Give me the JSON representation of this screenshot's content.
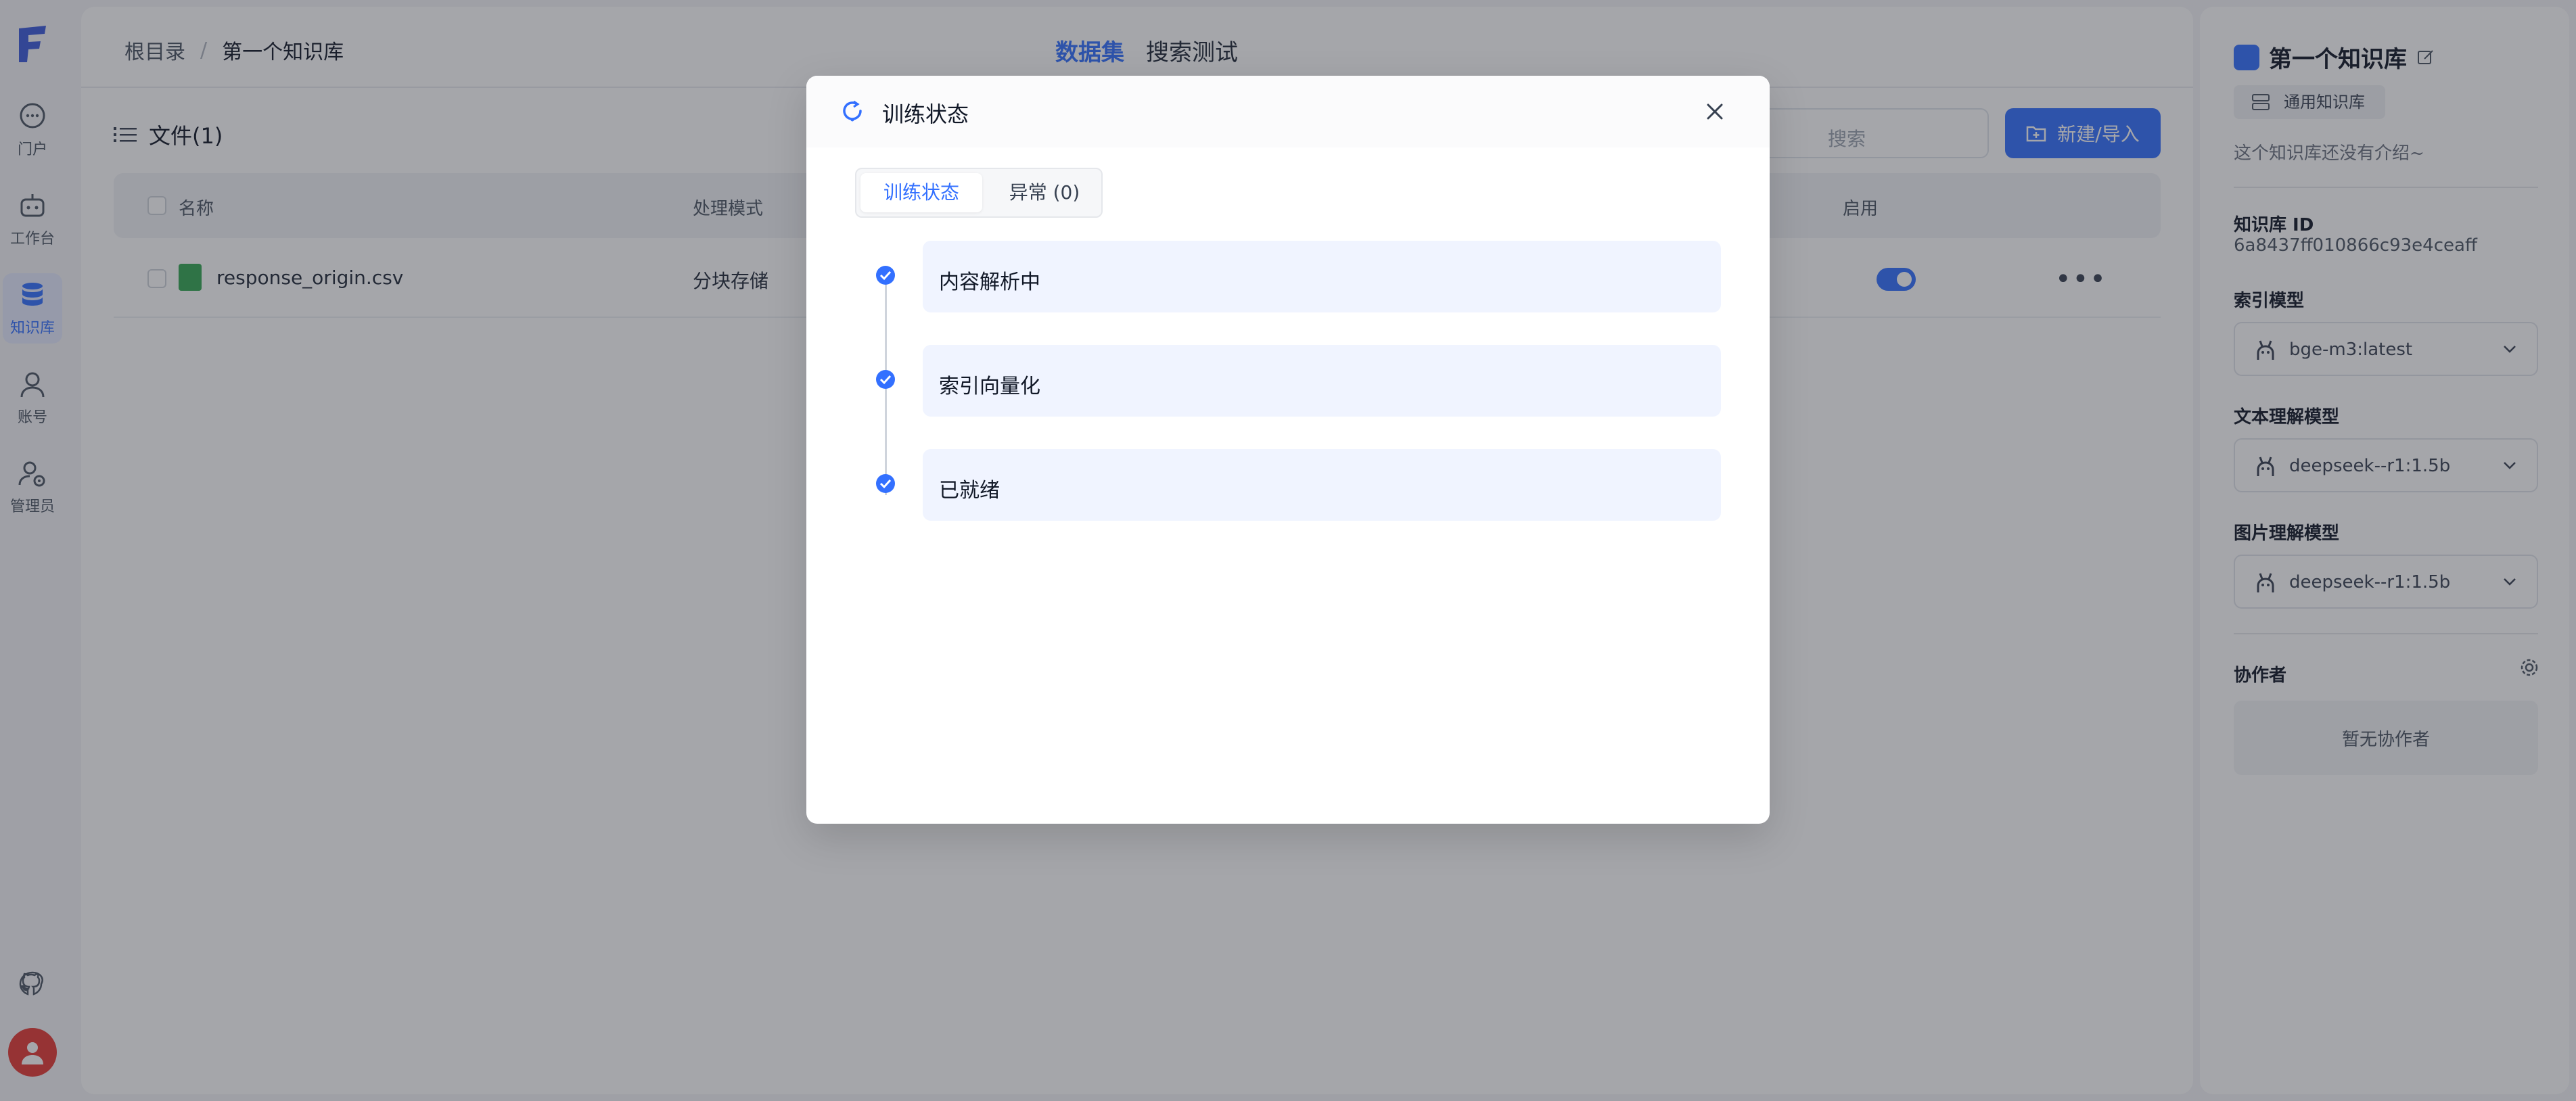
{
  "nav": {
    "items": [
      {
        "label": "门户",
        "icon": "chat-bubble-icon"
      },
      {
        "label": "工作台",
        "icon": "robot-icon"
      },
      {
        "label": "知识库",
        "icon": "database-icon"
      },
      {
        "label": "账号",
        "icon": "user-icon"
      },
      {
        "label": "管理员",
        "icon": "user-gear-icon"
      }
    ]
  },
  "header": {
    "breadcrumb_root": "根目录",
    "breadcrumb_sep": "/",
    "breadcrumb_current": "第一个知识库",
    "tab_dataset": "数据集",
    "tab_search_test": "搜索测试"
  },
  "files": {
    "title": "文件(1)",
    "search_placeholder": "搜索",
    "new_import_label": "新建/导入",
    "columns": {
      "name": "名称",
      "mode": "处理模式",
      "enabled": "启用"
    },
    "rows": [
      {
        "name": "response_origin.csv",
        "mode": "分块存储",
        "enabled": true
      }
    ]
  },
  "right_panel": {
    "kb_name": "第一个知识库",
    "kb_type": "通用知识库",
    "description": "这个知识库还没有介绍~",
    "kb_id_label": "知识库 ID",
    "kb_id": "6a8437ff010866c93e4ceaff",
    "index_model_label": "索引模型",
    "index_model": "bge-m3:latest",
    "text_model_label": "文本理解模型",
    "text_model": "deepseek--r1:1.5b",
    "image_model_label": "图片理解模型",
    "image_model": "deepseek--r1:1.5b",
    "collaborators_label": "协作者",
    "no_collaborators": "暂无协作者"
  },
  "modal": {
    "title": "训练状态",
    "tab_active": "训练状态",
    "tab_errors": "异常 (0)",
    "steps": [
      "内容解析中",
      "索引向量化",
      "已就绪"
    ]
  },
  "colors": {
    "accent": "#3370ff",
    "success": "#3370ff",
    "csv": "#34a853",
    "avatar": "#e53935"
  }
}
